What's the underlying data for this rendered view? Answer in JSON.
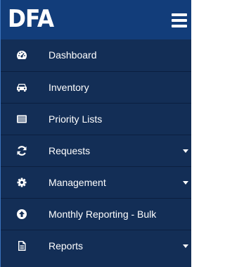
{
  "brand": {
    "title": "DFA"
  },
  "menu": {
    "items": [
      {
        "label": "Dashboard",
        "icon": "dashboard-gauge-icon",
        "has_submenu": false
      },
      {
        "label": "Inventory",
        "icon": "car-icon",
        "has_submenu": false
      },
      {
        "label": "Priority Lists",
        "icon": "list-alt-icon",
        "has_submenu": false
      },
      {
        "label": "Requests",
        "icon": "refresh-icon",
        "has_submenu": true
      },
      {
        "label": "Management",
        "icon": "gear-icon",
        "has_submenu": true
      },
      {
        "label": "Monthly Reporting - Bulk",
        "icon": "arrow-circle-up-icon",
        "has_submenu": false
      },
      {
        "label": "Reports",
        "icon": "file-text-icon",
        "has_submenu": true
      }
    ]
  },
  "colors": {
    "sidebar_bg": "#132e56",
    "topbar_bg": "#123d7a",
    "text": "#ffffff",
    "divider": "#0b1f3f"
  }
}
